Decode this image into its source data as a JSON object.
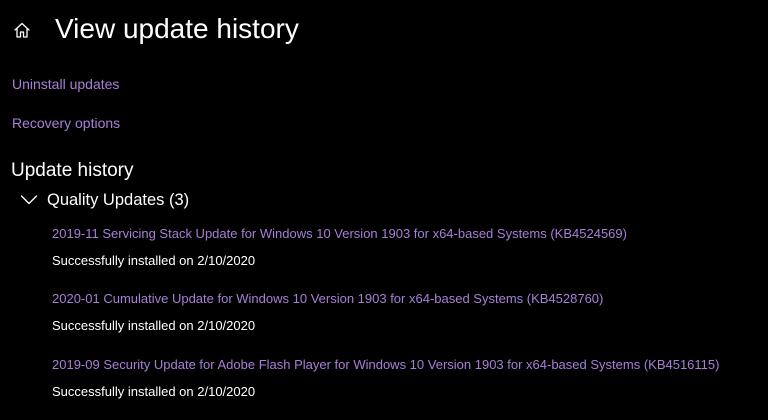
{
  "header": {
    "title": "View update history",
    "home_icon": "home-icon"
  },
  "links": {
    "uninstall": "Uninstall updates",
    "recovery": "Recovery options"
  },
  "history": {
    "section_title": "Update history",
    "group": {
      "label": "Quality Updates (3)",
      "icon": "chevron-down-icon",
      "expanded": true
    },
    "updates": [
      {
        "title": "2019-11 Servicing Stack Update for Windows 10 Version 1903 for x64-based Systems (KB4524569)",
        "status": "Successfully installed on 2/10/2020"
      },
      {
        "title": "2020-01 Cumulative Update for Windows 10 Version 1903 for x64-based Systems (KB4528760)",
        "status": "Successfully installed on 2/10/2020"
      },
      {
        "title": "2019-09 Security Update for Adobe Flash Player for Windows 10 Version 1903 for x64-based Systems (KB4516115)",
        "status": "Successfully installed on 2/10/2020"
      }
    ]
  },
  "colors": {
    "background": "#000000",
    "text": "#ffffff",
    "link": "#a77fd6"
  }
}
